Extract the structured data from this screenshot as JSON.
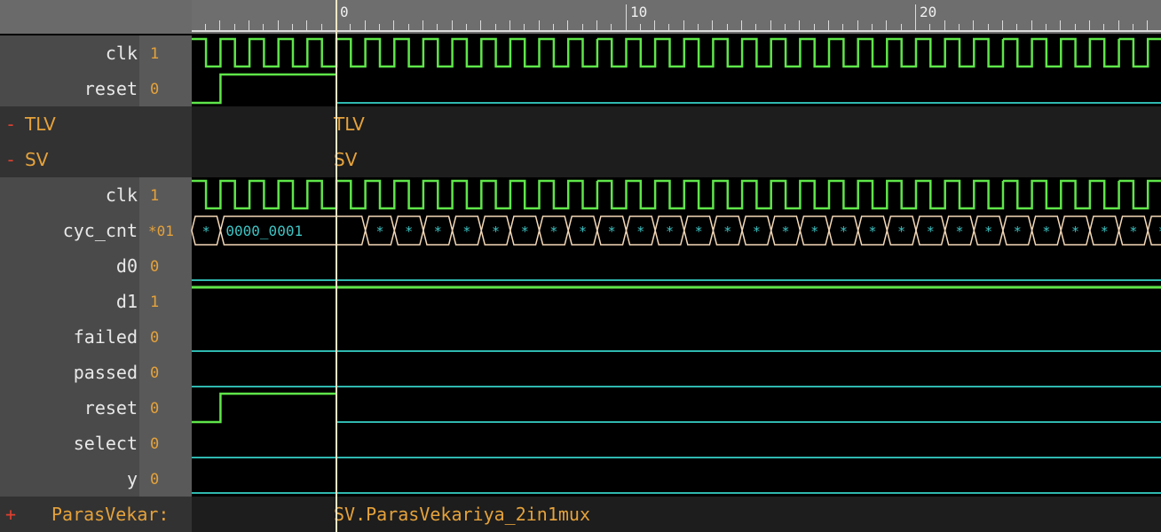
{
  "timeline": {
    "labels": [
      {
        "value": "0",
        "cycle": 0
      },
      {
        "value": "10",
        "cycle": 10
      },
      {
        "value": "20",
        "cycle": 20
      }
    ]
  },
  "top_signals": [
    {
      "name": "clk",
      "value": "1",
      "type": "clock"
    },
    {
      "name": "reset",
      "value": "0",
      "type": "reset"
    }
  ],
  "scopes": [
    {
      "toggle": "-",
      "name": "TLV",
      "label": "TLV"
    },
    {
      "toggle": "-",
      "name": "SV",
      "label": "SV"
    }
  ],
  "sv_signals": [
    {
      "name": "clk",
      "value": "1",
      "type": "clock"
    },
    {
      "name": "cyc_cnt",
      "value": "*01",
      "type": "bus",
      "bus_label": "0000_0001",
      "cell_label": "*"
    },
    {
      "name": "d0",
      "value": "0",
      "type": "low"
    },
    {
      "name": "d1",
      "value": "1",
      "type": "high"
    },
    {
      "name": "failed",
      "value": "0",
      "type": "low"
    },
    {
      "name": "passed",
      "value": "0",
      "type": "low"
    },
    {
      "name": "reset",
      "value": "0",
      "type": "reset"
    },
    {
      "name": "select",
      "value": "0",
      "type": "low"
    },
    {
      "name": "y",
      "value": "0",
      "type": "low"
    }
  ],
  "footer": {
    "toggle": "+",
    "name": "ParasVekar:",
    "path": "SV.ParasVekariya_2in1mux"
  },
  "colors": {
    "clock": "#5fe64a",
    "high": "#5fe64a",
    "low": "#2fb8b0",
    "bus": "#f5d9b8",
    "bus_text": "#3ec3c3",
    "cursor": "#f3e6c6"
  }
}
